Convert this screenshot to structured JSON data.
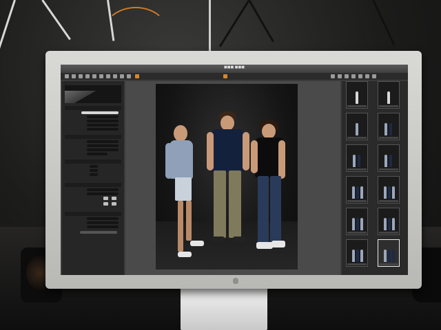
{
  "scene": {
    "description_tags": [
      "studio",
      "tethered-shooting",
      "photo-review-monitor"
    ],
    "colors": {
      "bezel": "#c9c9c6",
      "app_background": "#3b3b3b",
      "panel": "#262626",
      "accent": "#d8872a",
      "selected_thumb_border": "#eeeeee"
    }
  },
  "app": {
    "toolbar_icons": [
      "import-icon",
      "rotate-icon",
      "crop-icon",
      "straighten-icon",
      "keystone-icon",
      "spot-icon",
      "wb-picker-icon",
      "exposure-warning-icon",
      "loupe-icon",
      "capture-icon"
    ],
    "viewer_icons": [
      "grid-icon",
      "filmstrip-icon",
      "browser-icon",
      "viewer-icon",
      "multi-view-icon",
      "full-screen-icon",
      "proof-icon"
    ]
  },
  "left_panel": {
    "sections": [
      "histogram",
      "next-capture-naming",
      "next-capture-adjustments",
      "camera-controls",
      "exposure",
      "output"
    ],
    "rows_count_hint": 22
  },
  "viewer": {
    "people_count": 3
  },
  "filmstrip": {
    "thumbnail_count": 12,
    "selected_index": 11
  }
}
